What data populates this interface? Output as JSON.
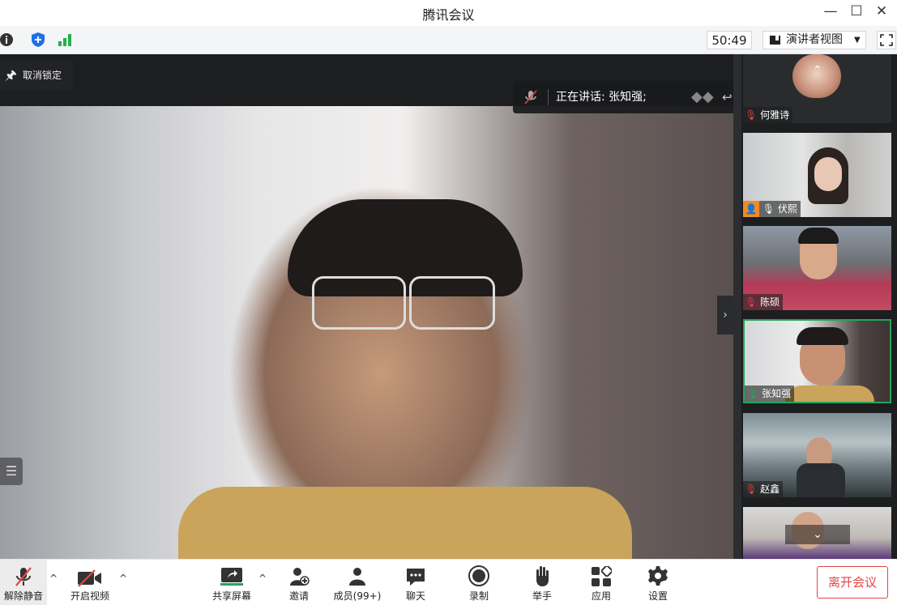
{
  "window": {
    "title": "腾讯会议"
  },
  "status": {
    "timer": "50:49",
    "view_mode": "演讲者视图"
  },
  "stage": {
    "unlock_label": "取消锁定",
    "speaking_label": "正在讲话: 张知强;"
  },
  "participants": [
    {
      "name": "何雅诗",
      "muted": true,
      "active": false
    },
    {
      "name": "伏熙",
      "muted": false,
      "active": false,
      "host": true
    },
    {
      "name": "陈硕",
      "muted": true,
      "active": false
    },
    {
      "name": "张知强",
      "muted": false,
      "active": true
    },
    {
      "name": "赵鑫",
      "muted": true,
      "active": false
    }
  ],
  "toolbar": {
    "unmute": "解除静音",
    "video": "开启视频",
    "share": "共享屏幕",
    "invite": "邀请",
    "members": "成员(99+)",
    "chat": "聊天",
    "record": "录制",
    "raise_hand": "举手",
    "apps": "应用",
    "settings": "设置",
    "leave": "离开会议"
  },
  "colors": {
    "accent_green": "#22a658",
    "leave_red": "#e54545",
    "signal_green": "#22b14c",
    "shield_blue": "#1e6fe8"
  }
}
